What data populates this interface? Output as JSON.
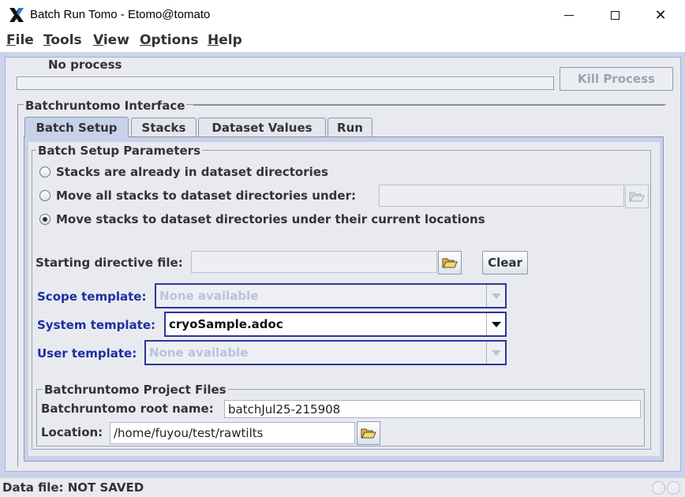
{
  "window": {
    "title": "Batch Run Tomo - Etomo@tomato",
    "app_icon": "x-logo-icon",
    "controls": {
      "minimize": "minimize-icon",
      "maximize": "maximize-icon",
      "close": "✕"
    }
  },
  "menu": {
    "items": [
      {
        "mnemonic": "F",
        "rest": "ile"
      },
      {
        "mnemonic": "T",
        "rest": "ools"
      },
      {
        "mnemonic": "V",
        "rest": "iew"
      },
      {
        "mnemonic": "O",
        "rest": "ptions"
      },
      {
        "mnemonic": "H",
        "rest": "elp"
      }
    ]
  },
  "process": {
    "status": "No process",
    "kill_button": "Kill Process"
  },
  "interface": {
    "title": "Batchruntomo Interface",
    "tabs": [
      "Batch Setup",
      "Stacks",
      "Dataset Values",
      "Run"
    ],
    "active_tab": "Batch Setup"
  },
  "batch_setup": {
    "title": "Batch Setup Parameters",
    "radio_options": [
      "Stacks are already in dataset directories",
      "Move all stacks to dataset directories under:",
      "Move stacks to dataset directories under their current locations"
    ],
    "selected_option": 2,
    "move_all_path": "",
    "starting_directive_label": "Starting directive file:",
    "starting_directive_value": "",
    "clear_button": "Clear",
    "scope_template_label": "Scope template:",
    "scope_template_value": "None available",
    "system_template_label": "System template:",
    "system_template_value": "cryoSample.adoc",
    "user_template_label": "User template:",
    "user_template_value": "None available"
  },
  "project_files": {
    "title": "Batchruntomo Project Files",
    "root_name_label": "Batchruntomo root name:",
    "root_name_value": "batchJul25-215908",
    "location_label": "Location:",
    "location_value": "/home/fuyou/test/rawtilts"
  },
  "status_bar": {
    "text": "Data file: NOT SAVED"
  },
  "colors": {
    "frame_blue": "#c9d3ea",
    "label_blue": "#1d2fa3",
    "combo_border": "#2a3699"
  }
}
